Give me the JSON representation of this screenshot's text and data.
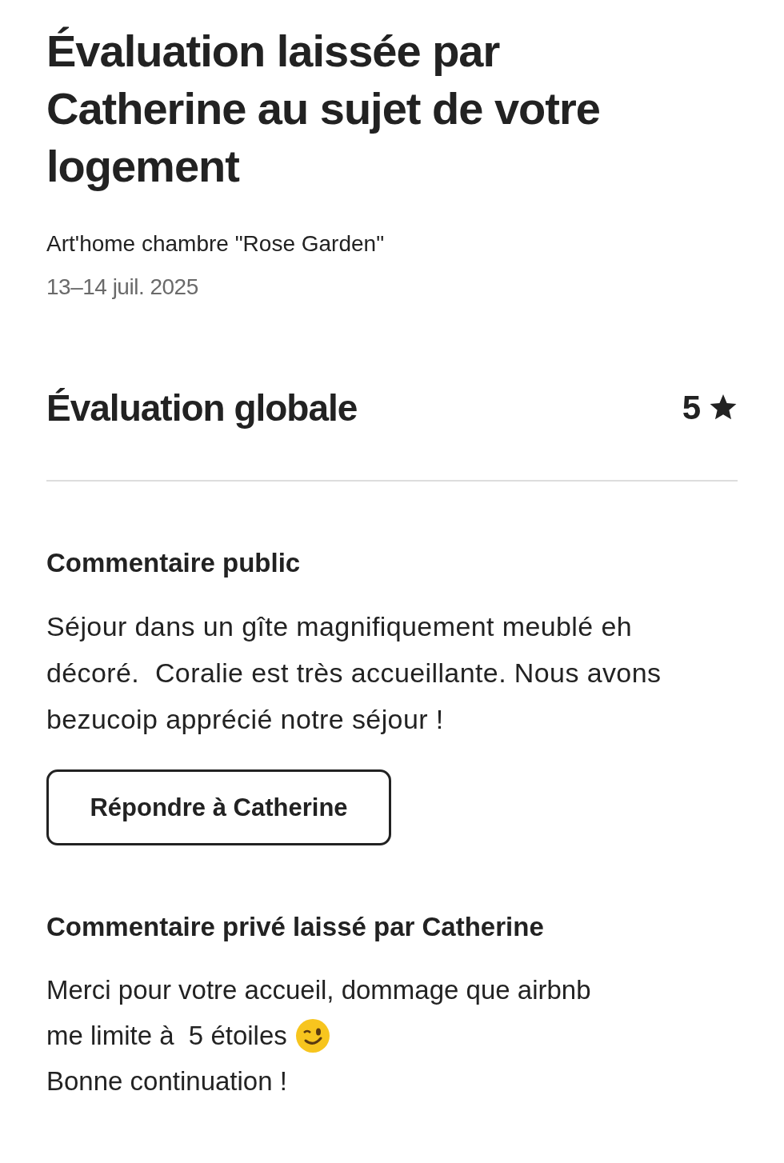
{
  "title": "Évaluation laissée par Catherine au sujet de votre logement",
  "listing": "Art'home chambre \"Rose Garden\"",
  "dates": "13–14 juil. 2025",
  "overall": {
    "label": "Évaluation globale",
    "rating": "5"
  },
  "public_comment": {
    "heading": "Commentaire public",
    "text": "Séjour dans un gîte magnifiquement meublé eh décoré.  Coralie est très accueillante. Nous avons bezucoip apprécié notre séjour !",
    "reply_button": "Répondre à Catherine"
  },
  "private_comment": {
    "heading": "Commentaire privé laissé par Catherine",
    "lines": [
      {
        "text": "Merci pour votre accueil, dommage que airbnb",
        "emoji": false
      },
      {
        "text": "me limite à  5 étoiles",
        "emoji": true
      },
      {
        "text": "Bonne continuation !",
        "emoji": false
      }
    ]
  }
}
